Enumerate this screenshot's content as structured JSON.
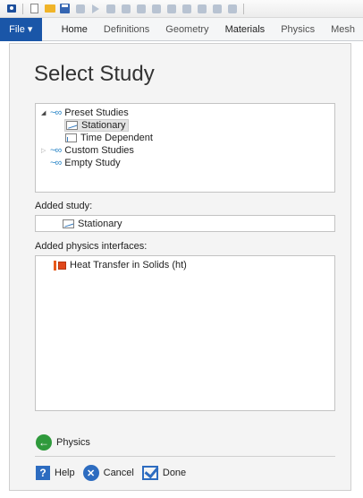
{
  "toolbar": {
    "icons": [
      "app-icon",
      "new-icon",
      "open-icon",
      "save-icon",
      "save-as-icon",
      "run-icon",
      "undo-icon",
      "redo-icon",
      "copy-icon",
      "paste-icon",
      "duplicate-icon",
      "delete-icon",
      "select-icon",
      "build-icon",
      "compute-icon"
    ]
  },
  "ribbon": {
    "file": "File ▾",
    "tabs": [
      "Home",
      "Definitions",
      "Geometry",
      "Materials",
      "Physics",
      "Mesh"
    ]
  },
  "wizard": {
    "title": "Select Study",
    "tree": {
      "preset_studies": "Preset Studies",
      "stationary": "Stationary",
      "time_dependent": "Time Dependent",
      "custom_studies": "Custom Studies",
      "empty_study": "Empty Study"
    },
    "added_study_label": "Added study:",
    "added_study_value": "Stationary",
    "added_physics_label": "Added physics interfaces:",
    "physics_items": [
      "Heat Transfer in Solids (ht)"
    ],
    "nav_back": "Physics",
    "help": "Help",
    "cancel": "Cancel",
    "done": "Done"
  },
  "colors": {
    "file_tab": "#1a56a8",
    "accent_blue": "#2d6cc0",
    "back_green": "#2f9a3c",
    "physics_orange": "#e0471a"
  }
}
